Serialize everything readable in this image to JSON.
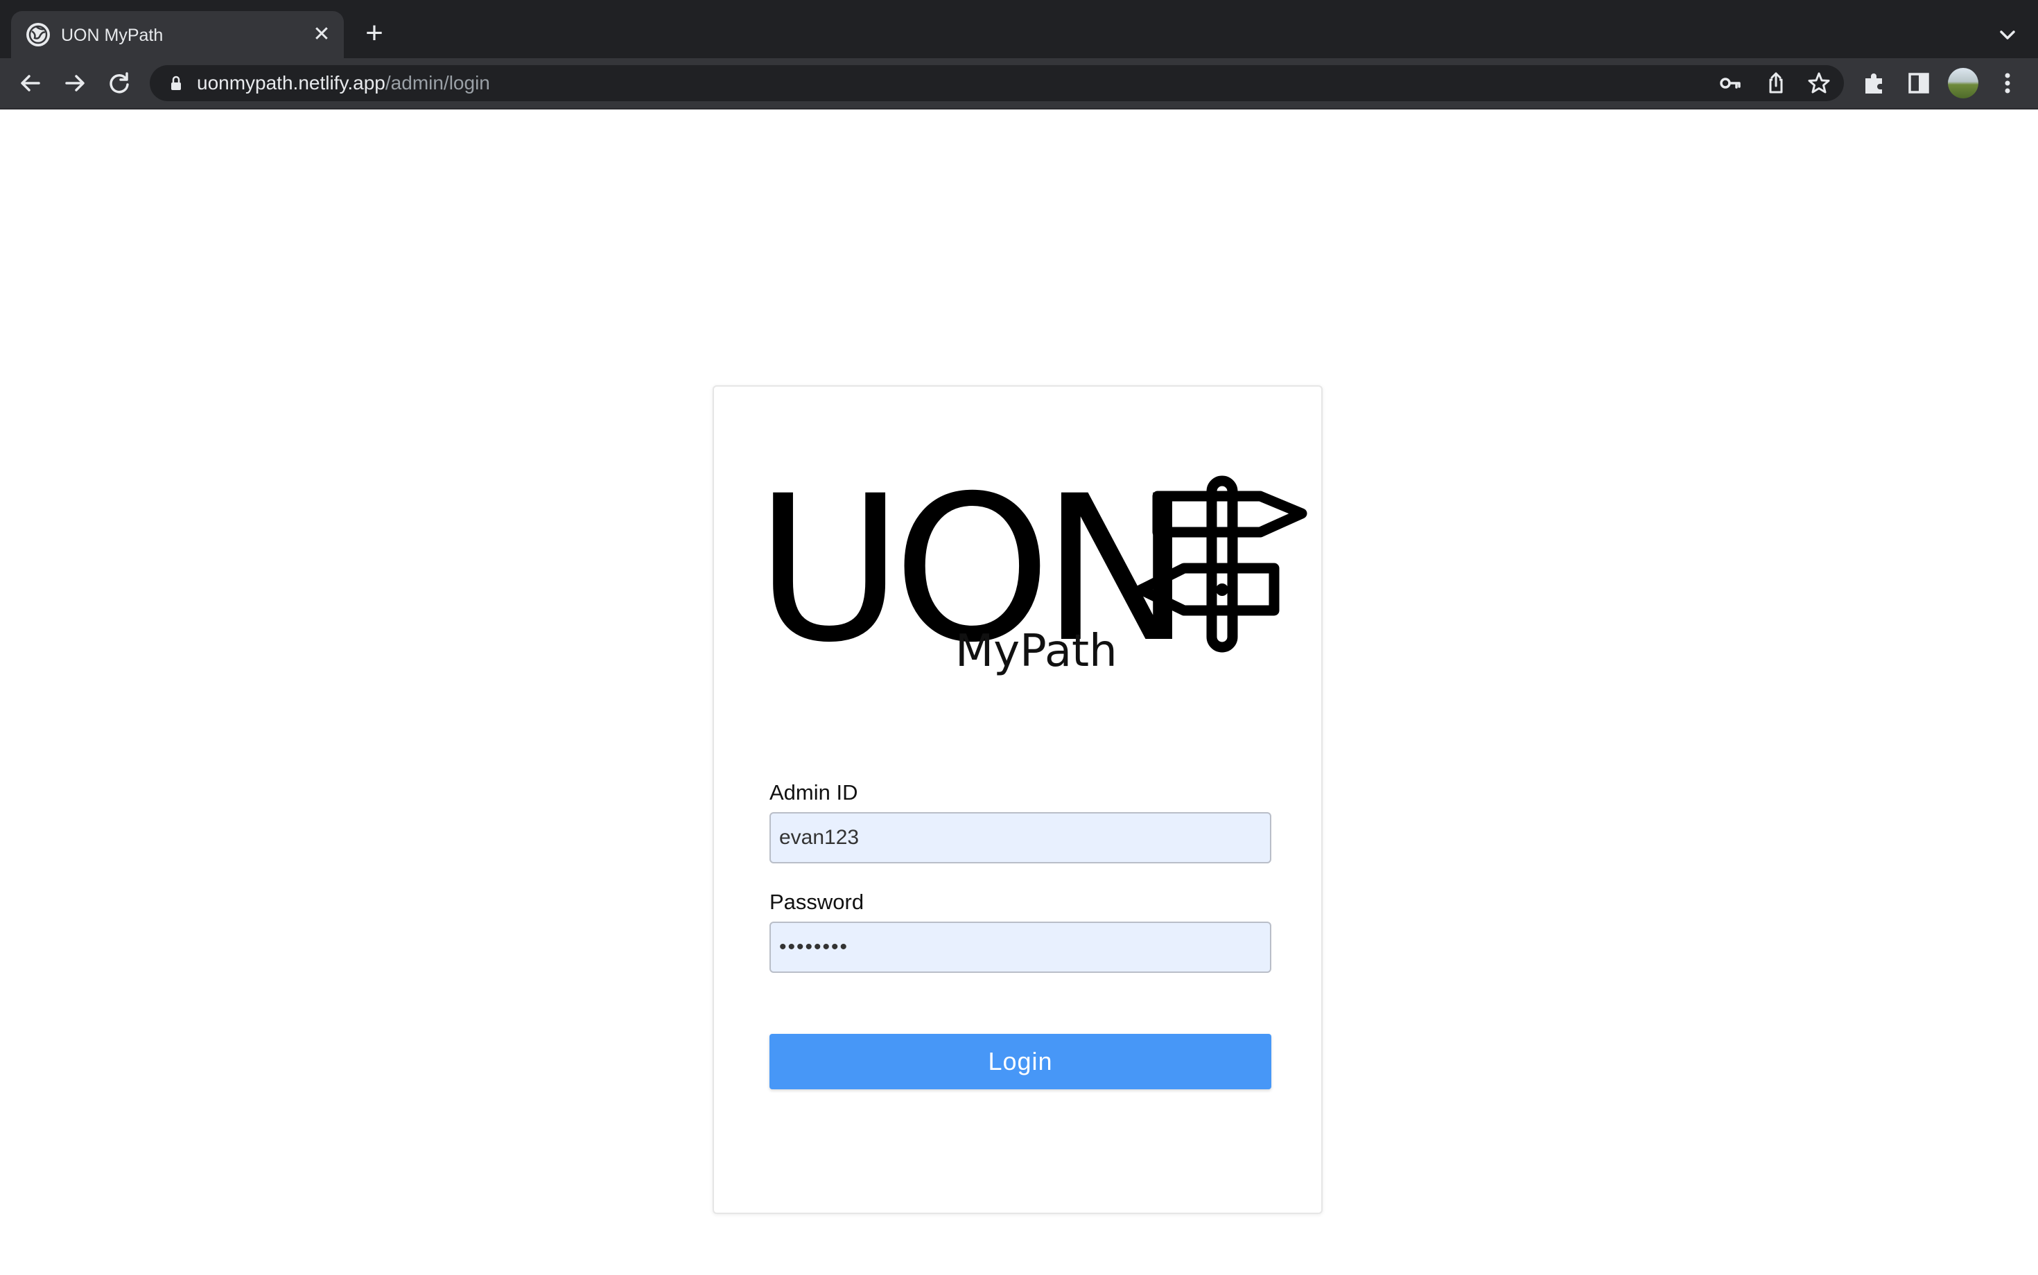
{
  "browser": {
    "tab_title": "UON MyPath",
    "tab_close": "✕",
    "new_tab": "+",
    "url_host": "uonmypath.netlify.app",
    "url_path": "/admin/login"
  },
  "logo": {
    "wordmark": "UON",
    "subtitle": "MyPath"
  },
  "form": {
    "admin_id_label": "Admin ID",
    "admin_id_value": "evan123",
    "password_label": "Password",
    "password_value": "••••••••",
    "login_label": "Login"
  },
  "colors": {
    "button": "#4797f7",
    "input_bg": "#e8f0fe",
    "chrome_dark": "#202124"
  }
}
